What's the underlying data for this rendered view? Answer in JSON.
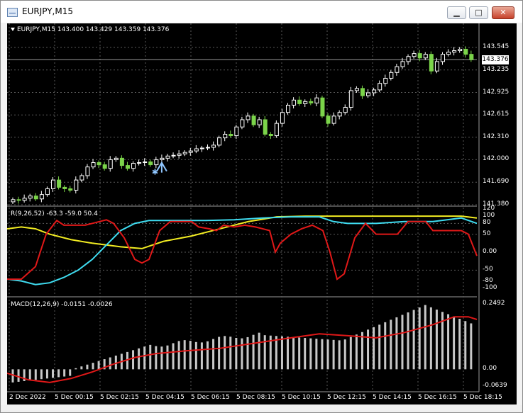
{
  "window": {
    "title": "EURJPY,M15",
    "buttons": {
      "minimize": "▁",
      "maximize": "□",
      "close": "✕"
    }
  },
  "symbol_bar": {
    "text": "EURJPY,M15  143.400 143.429 143.359 143.376"
  },
  "price_axis": {
    "labels": [
      "143.545",
      "143.235",
      "142.925",
      "142.615",
      "142.310",
      "142.000",
      "141.690",
      "141.380"
    ],
    "current": "143.376"
  },
  "rsi_panel": {
    "label": "R(9,26,52) -63.3 -59.0 50.4",
    "scale": [
      "120",
      "100",
      "80",
      "50",
      "0.00",
      "-50",
      "-80",
      "-100"
    ]
  },
  "macd_panel": {
    "label": "MACD(12,26,9) -0.0151 -0.0026",
    "scale": [
      "0.2492",
      "0.00",
      "-0.0639"
    ]
  },
  "time_axis": [
    "2 Dec 2022",
    "5 Dec 00:15",
    "5 Dec 02:15",
    "5 Dec 04:15",
    "5 Dec 06:15",
    "5 Dec 08:15",
    "5 Dec 10:15",
    "5 Dec 12:15",
    "5 Dec 14:15",
    "5 Dec 16:15",
    "5 Dec 18:15"
  ],
  "colors": {
    "background": "#000000",
    "grid": "#5a5a5a",
    "bull": "#ffffff",
    "bear": "#7bd44a",
    "rsi_fast": "#e01818",
    "rsi_mid": "#3fdcf0",
    "rsi_slow": "#f2ec22",
    "macd_hist": "#c8c8c8",
    "macd_signal": "#e01818",
    "signal_arrow": "#8fc6ff"
  },
  "chart_data": {
    "type": "candlestick",
    "ylim": [
      141.38,
      143.7
    ],
    "closes": [
      141.45,
      141.44,
      141.47,
      141.5,
      141.46,
      141.52,
      141.6,
      141.72,
      141.62,
      141.6,
      141.58,
      141.72,
      141.78,
      141.9,
      141.96,
      141.93,
      141.88,
      142.0,
      142.02,
      141.92,
      141.88,
      141.95,
      141.96,
      141.97,
      141.93,
      142.0,
      142.02,
      142.05,
      142.06,
      142.08,
      142.1,
      142.12,
      142.15,
      142.16,
      142.17,
      142.2,
      142.3,
      142.35,
      142.33,
      142.45,
      142.55,
      142.6,
      142.48,
      142.55,
      142.35,
      142.33,
      142.5,
      142.65,
      142.75,
      142.82,
      142.77,
      142.8,
      142.78,
      142.85,
      142.6,
      142.5,
      142.6,
      142.65,
      142.72,
      142.95,
      142.98,
      142.88,
      142.92,
      142.96,
      143.05,
      143.12,
      143.2,
      143.28,
      143.35,
      143.42,
      143.46,
      143.4,
      143.45,
      143.22,
      143.35,
      143.45,
      143.48,
      143.5,
      143.52,
      143.45,
      143.376
    ]
  }
}
